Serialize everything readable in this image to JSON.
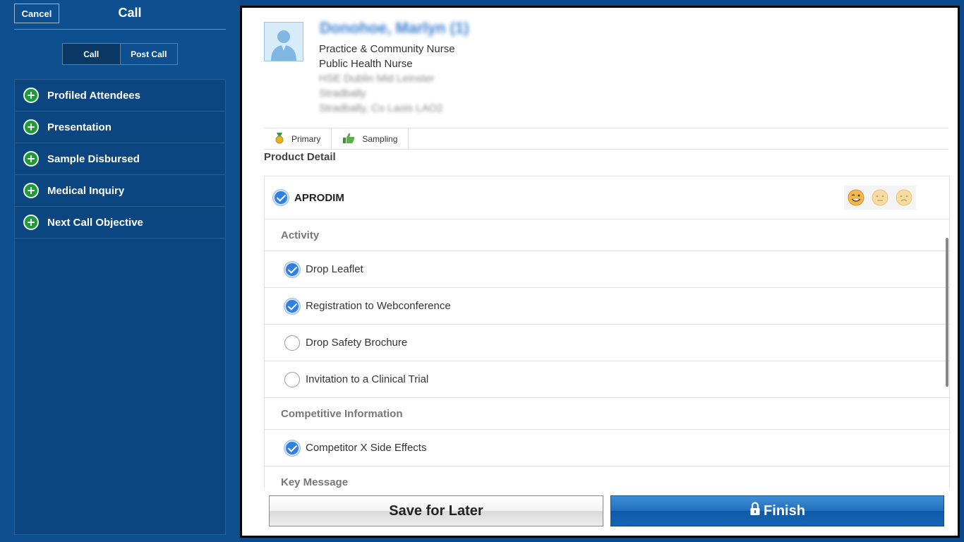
{
  "header": {
    "cancel_label": "Cancel",
    "title": "Call"
  },
  "segment": {
    "call_label": "Call",
    "post_call_label": "Post Call",
    "active": "Call"
  },
  "menu": {
    "items": [
      {
        "label": "Profiled Attendees",
        "icon": "plus-circle-icon"
      },
      {
        "label": "Presentation",
        "icon": "plus-circle-icon"
      },
      {
        "label": "Sample Disbursed",
        "icon": "plus-circle-icon"
      },
      {
        "label": "Medical Inquiry",
        "icon": "plus-circle-icon"
      },
      {
        "label": "Next Call Objective",
        "icon": "plus-circle-icon"
      }
    ]
  },
  "contact": {
    "name": "Donohoe, Marlyn (1)",
    "title1": "Practice & Community Nurse",
    "title2": "Public Health Nurse",
    "address1": "HSE Dublin Mid Leinster",
    "address2": "Stradbally",
    "address3": "Stradbally, Co Laois LAO2"
  },
  "tabs": [
    {
      "label": "Primary",
      "icon": "medal-icon"
    },
    {
      "label": "Sampling",
      "icon": "thumbs-up-icon"
    }
  ],
  "product_detail": {
    "title": "Product Detail",
    "product": {
      "name": "APRODIM",
      "checked": true
    },
    "sentiment_icons": [
      "happy-smiley-icon",
      "neutral-smiley-icon",
      "sad-smiley-icon"
    ],
    "sections": [
      {
        "title": "Activity",
        "items": [
          {
            "label": "Drop Leaflet",
            "checked": true
          },
          {
            "label": "Registration to Webconference",
            "checked": true
          },
          {
            "label": "Drop Safety Brochure",
            "checked": false
          },
          {
            "label": "Invitation to a Clinical Trial",
            "checked": false
          }
        ]
      },
      {
        "title": "Competitive Information",
        "items": [
          {
            "label": "Competitor X Side Effects",
            "checked": true
          }
        ]
      },
      {
        "title": "Key Message",
        "items": []
      }
    ]
  },
  "buttons": {
    "save_label": "Save for Later",
    "finish_label": "Finish"
  },
  "colors": {
    "sidebar_bg": "#0d4f8f",
    "accent_blue": "#1f6fbf",
    "check_blue": "#2f80e0",
    "plus_green": "#1e9a3a"
  }
}
